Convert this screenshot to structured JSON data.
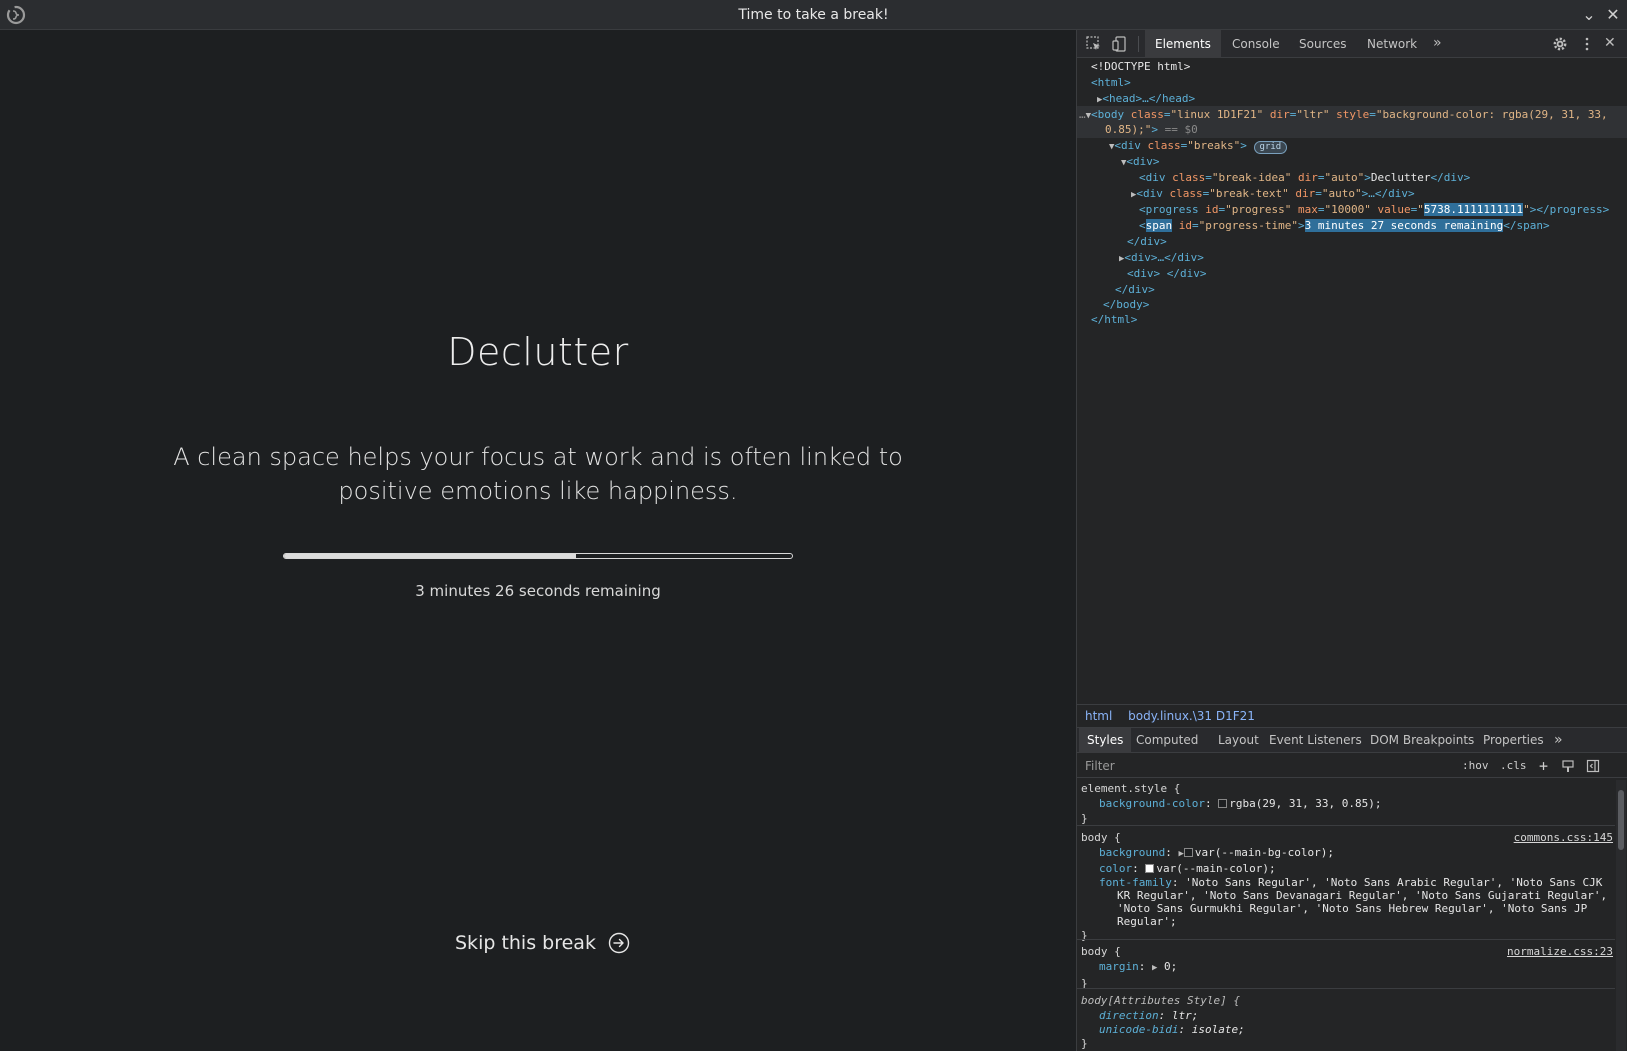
{
  "window": {
    "title": "Time to take a break!"
  },
  "break": {
    "idea": "Declutter",
    "text": "A clean space helps your focus at work and is often linked to positive emotions like happiness.",
    "progress_fraction": 0.574,
    "progress_time": "3 minutes 26 seconds remaining",
    "skip_label": "Skip this break"
  },
  "devtools": {
    "tabs": [
      "Elements",
      "Console",
      "Sources",
      "Network"
    ],
    "dom": {
      "doctype": "<!DOCTYPE html>",
      "html_open": "<html>",
      "head": "<head>…</head>",
      "body_class": "\"linux 1D1F21\"",
      "body_dir": "\"ltr\"",
      "body_style": "\"background-color: rgba(29, 31, 33,",
      "body_style_cont": "0.85);\"",
      "body_eq": "== $0",
      "breaks_class": "\"breaks\"",
      "grid_badge": "grid",
      "div_open": "<div>",
      "break_idea_class": "\"break-idea\"",
      "break_idea_dir": "\"auto\"",
      "break_idea_text": "Declutter",
      "break_text_class": "\"break-text\"",
      "break_text_dir": "\"auto\"",
      "progress_id": "\"progress\"",
      "progress_max": "\"10000\"",
      "progress_value": "5738.1111111111",
      "span_id": "\"progress-time\"",
      "span_text": "3 minutes 27 seconds remaining",
      "div_close": "</div>",
      "div_collapsed": "<div>…</div>",
      "div_empty": "<div> </div>",
      "body_close": "</body>",
      "html_close": "</html>"
    },
    "breadcrumb": [
      "html",
      "body.linux.\\31 D1F21"
    ],
    "styles_tabs": [
      "Styles",
      "Computed",
      "Layout",
      "Event Listeners",
      "DOM Breakpoints",
      "Properties"
    ],
    "filter_placeholder": "Filter",
    "filter_buttons": [
      ":hov",
      ".cls",
      "+"
    ],
    "rules": {
      "element_style_sel": "element.style {",
      "element_style_bg_name": "background-color",
      "element_style_bg_val": "rgba(29, 31, 33, 0.85);",
      "body1_sel": "body {",
      "body1_src": "commons.css:145",
      "body1_bg_name": "background",
      "body1_bg_val": "var(--main-bg-color);",
      "body1_color_name": "color",
      "body1_color_val": "var(--main-color);",
      "body1_font_name": "font-family",
      "body1_font_l1": "'Noto Sans Regular', 'Noto Sans Arabic Regular', 'Noto Sans CJK",
      "body1_font_l2": "KR Regular', 'Noto Sans Devanagari Regular', 'Noto Sans Gujarati Regular',",
      "body1_font_l3": "'Noto Sans Gurmukhi Regular', 'Noto Sans Hebrew Regular', 'Noto Sans JP",
      "body1_font_l4": "Regular';",
      "body2_sel": "body {",
      "body2_src": "normalize.css:23",
      "body2_margin_name": "margin",
      "body2_margin_val": "0;",
      "attr_sel": "body[Attributes Style] {",
      "attr_dir_name": "direction",
      "attr_dir_val": "ltr;",
      "attr_bidi_name": "unicode-bidi",
      "attr_bidi_val": "isolate;",
      "close": "}"
    },
    "colors": {
      "swatch_dark": "#1d1f21",
      "swatch_white": "#ffffff"
    }
  }
}
